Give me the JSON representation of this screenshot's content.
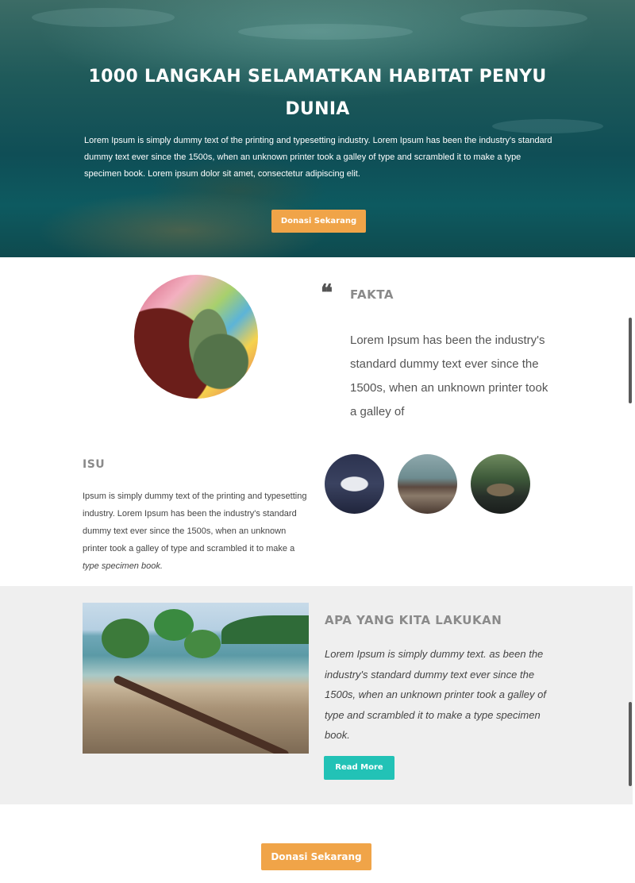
{
  "hero": {
    "title": "1000 LANGKAH SELAMATKAN HABITAT PENYU DUNIA",
    "text": "Lorem Ipsum is simply dummy text of the printing and typesetting industry. Lorem Ipsum has been the industry's standard dummy text ever since the 1500s, when an unknown printer took a galley of type and scrambled it to make a type specimen book. Lorem ipsum dolor sit amet, consectetur adipiscing elit.",
    "button_label": "Donasi Sekarang"
  },
  "fakta": {
    "quote_glyph": "❝",
    "heading": "FAKTA",
    "text": "Lorem Ipsum has been the industry's standard dummy text ever since the 1500s, when an unknown printer took a galley of"
  },
  "isu": {
    "heading": "ISU",
    "text": "Ipsum is simply dummy text of the printing and typesetting industry. Lorem Ipsum has been the industry's standard dummy text ever since the 1500s, when an unknown printer took a galley of type and scrambled it to make a",
    "text_italic": "type specimen book."
  },
  "lakukan": {
    "heading": "APA YANG KITA LAKUKAN",
    "text": "Lorem Ipsum is simply dummy text. as been the industry's standard dummy text ever since the 1500s, when an unknown printer took a galley of type and scrambled it to make a type specimen book.",
    "button_label": "Read More"
  },
  "footer": {
    "button_label": "Donasi Sekarang"
  },
  "colors": {
    "accent_orange": "#f0a448",
    "accent_teal": "#22c2b6",
    "band_gray": "#efefef"
  }
}
